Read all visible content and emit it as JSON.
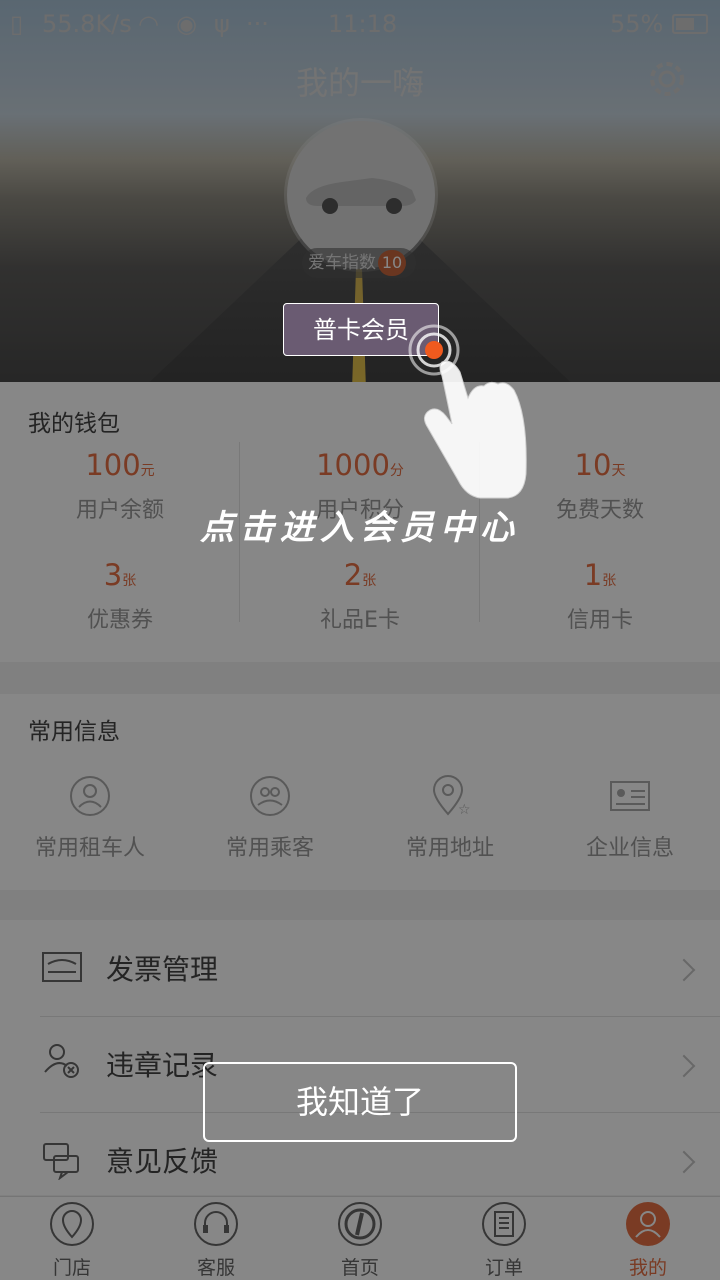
{
  "status_bar": {
    "speed": "55.8K/s",
    "time": "11:18",
    "battery": "55%"
  },
  "header": {
    "title": "我的一嗨",
    "settings_icon": "gear-icon",
    "love_car_label": "爱车指数",
    "love_car_value": "10",
    "member_label": "普卡会员"
  },
  "wallet": {
    "title": "我的钱包",
    "items": [
      {
        "value": "100",
        "unit": "元",
        "label": "用户余额"
      },
      {
        "value": "1000",
        "unit": "分",
        "label": "用户积分"
      },
      {
        "value": "10",
        "unit": "天",
        "label": "免费天数"
      },
      {
        "value": "3",
        "unit": "张",
        "label": "优惠券"
      },
      {
        "value": "2",
        "unit": "张",
        "label": "礼品E卡"
      },
      {
        "value": "1",
        "unit": "张",
        "label": "信用卡"
      }
    ]
  },
  "common_info": {
    "title": "常用信息",
    "items": [
      {
        "label": "常用租车人",
        "icon": "person-icon"
      },
      {
        "label": "常用乘客",
        "icon": "group-icon"
      },
      {
        "label": "常用地址",
        "icon": "location-star-icon"
      },
      {
        "label": "企业信息",
        "icon": "id-card-icon"
      }
    ]
  },
  "menu": [
    {
      "label": "发票管理",
      "icon": "invoice-icon"
    },
    {
      "label": "违章记录",
      "icon": "violation-icon"
    },
    {
      "label": "意见反馈",
      "icon": "feedback-icon"
    }
  ],
  "tabs": [
    {
      "label": "门店",
      "icon": "map-pin-icon"
    },
    {
      "label": "客服",
      "icon": "headset-icon"
    },
    {
      "label": "首页",
      "icon": "home-logo-icon"
    },
    {
      "label": "订单",
      "icon": "order-icon"
    },
    {
      "label": "我的",
      "icon": "profile-icon",
      "active": true
    }
  ],
  "guide": {
    "hint_text": "点击进入会员中心",
    "ok_button": "我知道了"
  },
  "colors": {
    "accent": "#e67045",
    "member_badge": "#6a5b72"
  }
}
